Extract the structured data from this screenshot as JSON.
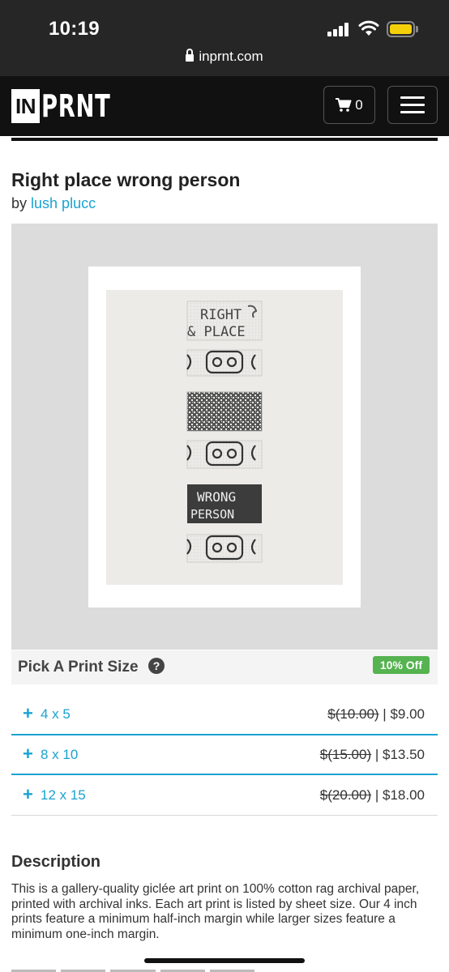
{
  "status_bar": {
    "time": "10:19"
  },
  "browser": {
    "url": "inprnt.com"
  },
  "header": {
    "logo_in": "IN",
    "logo_prnt": "PRNT",
    "cart_count": "0"
  },
  "product": {
    "title": "Right place wrong person",
    "by_prefix": "by",
    "artist": "lush plucc"
  },
  "artwork_text": {
    "line1": "RIGHT",
    "line2": "& PLACE",
    "line3": "WRONG",
    "line4": "PERSON"
  },
  "size_picker": {
    "title": "Pick A Print Size",
    "help": "?",
    "badge": "10% Off",
    "options": [
      {
        "label": "4 x 5",
        "old_price": "$(10.00)",
        "new_price": "$9.00"
      },
      {
        "label": "8 x 10",
        "old_price": "$(15.00)",
        "new_price": "$13.50"
      },
      {
        "label": "12 x 15",
        "old_price": "$(20.00)",
        "new_price": "$18.00"
      }
    ]
  },
  "description": {
    "heading": "Description",
    "text": "This is a gallery-quality giclée art print on 100% cotton rag archival paper, printed with archival inks. Each art print is listed by sheet size. Our 4 inch prints feature a minimum half-inch margin while larger sizes feature a minimum one-inch margin."
  },
  "colors": {
    "accent": "#1aa3d1",
    "badge": "#55b350",
    "header_bg": "#111111"
  }
}
